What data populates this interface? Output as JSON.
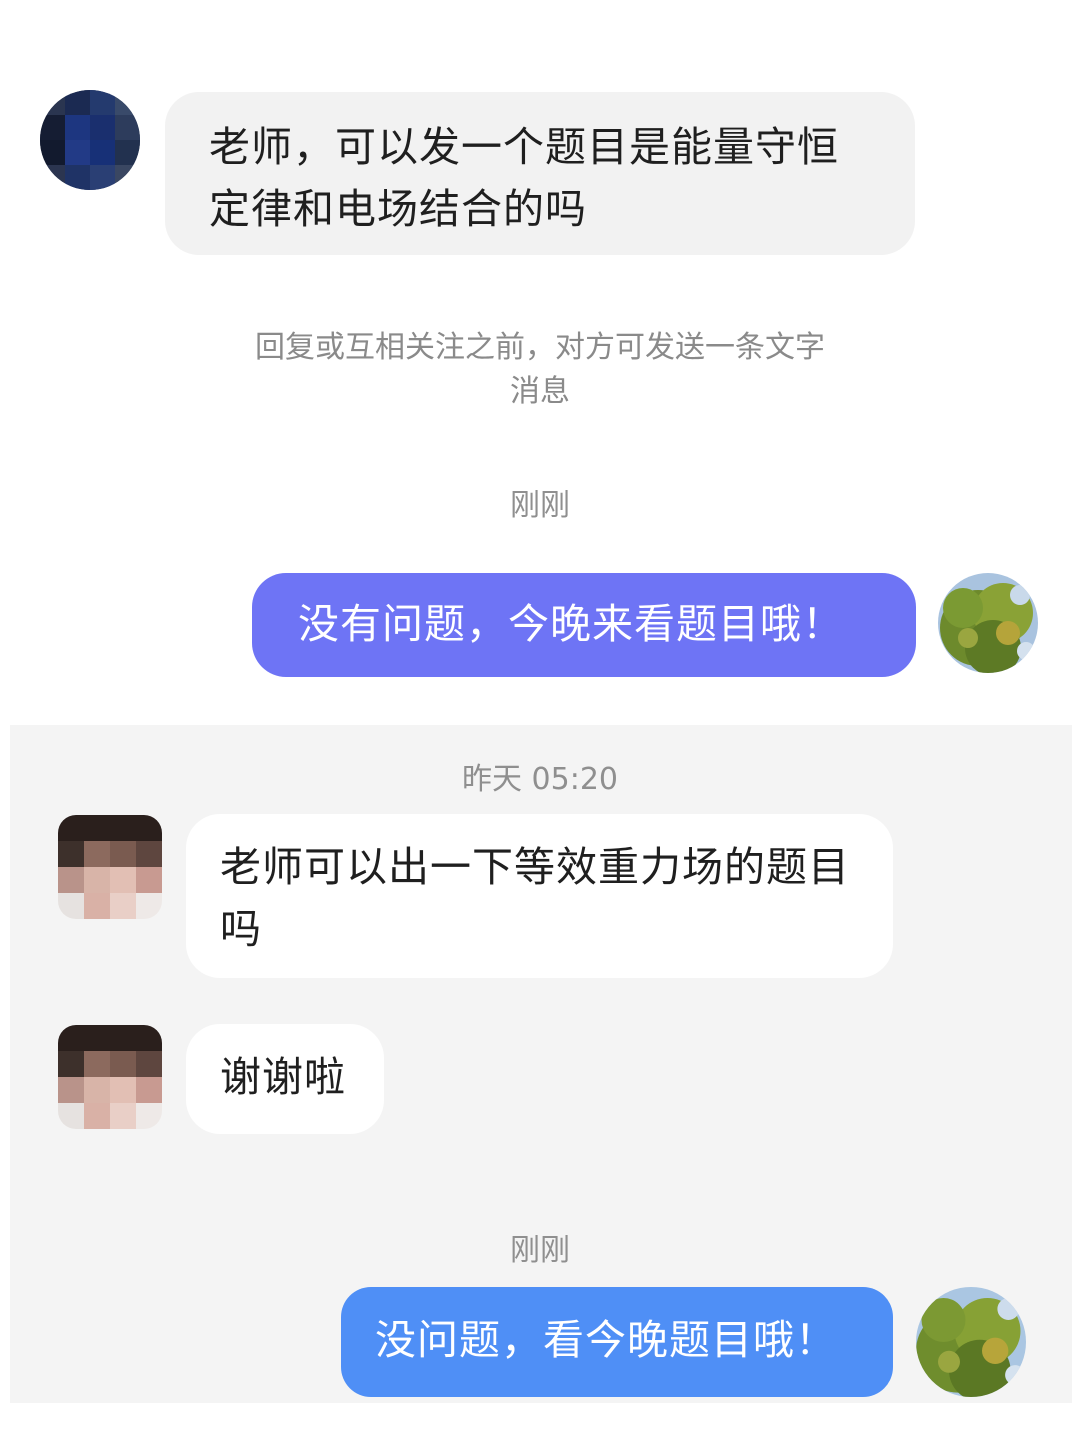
{
  "conversation_1": {
    "incoming": {
      "avatar_icon": "user-avatar-icon",
      "text": "老师，可以发一个题目是能量守恒定律和电场结合的吗"
    },
    "system_notice_line1": "回复或互相关注之前，对方可发送一条文字",
    "system_notice_line2": "消息",
    "timestamp": "刚刚",
    "outgoing": {
      "avatar_icon": "tree-avatar-icon",
      "text": "没有问题，今晚来看题目哦！",
      "color": "#6e74f5"
    }
  },
  "conversation_2": {
    "timestamp_top": "昨天 05:20",
    "incoming_1": {
      "avatar_icon": "user-avatar-icon",
      "text": "老师可以出一下等效重力场的题目吗"
    },
    "incoming_2": {
      "avatar_icon": "user-avatar-icon",
      "text": "谢谢啦"
    },
    "timestamp": "刚刚",
    "outgoing": {
      "avatar_icon": "tree-avatar-icon",
      "text": "没问题，看今晚题目哦！",
      "color": "#4f8ff6"
    }
  }
}
